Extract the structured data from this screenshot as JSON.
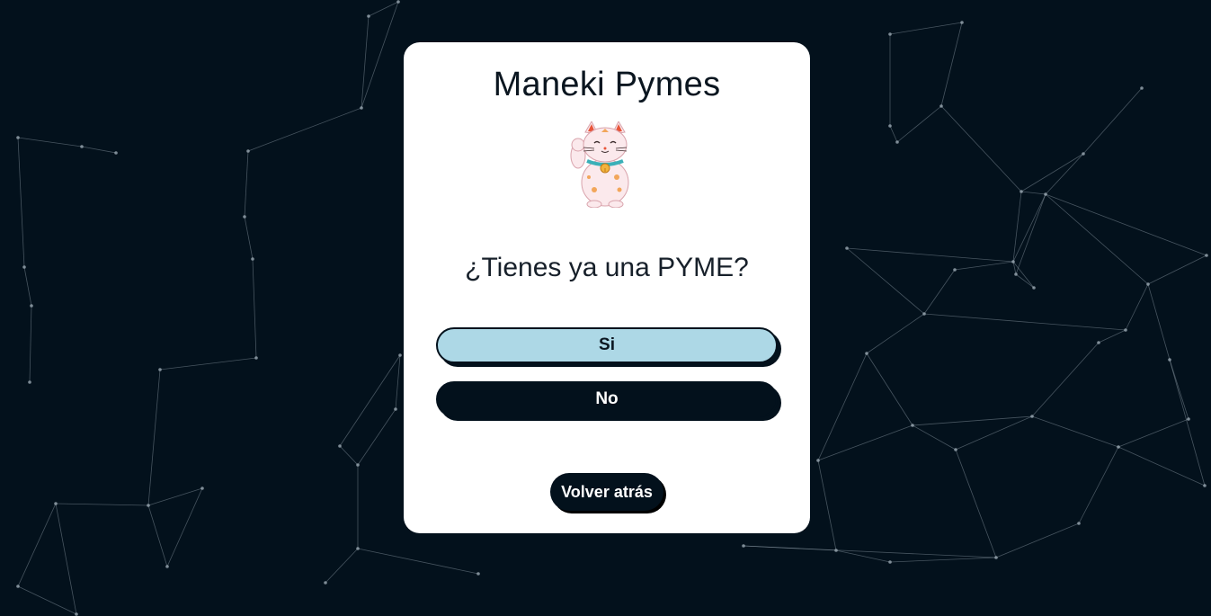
{
  "app": {
    "title": "Maneki Pymes",
    "mascot_icon": "maneki-neko-icon"
  },
  "question": {
    "text": "¿Tienes ya una PYME?"
  },
  "options": {
    "yes_label": "Si",
    "no_label": "No"
  },
  "navigation": {
    "back_label": "Volver atrás"
  },
  "colors": {
    "background": "#03111c",
    "card": "#ffffff",
    "yes_button": "#add8e6",
    "no_button": "#03111c",
    "network_lines": "#9aa7b2"
  }
}
